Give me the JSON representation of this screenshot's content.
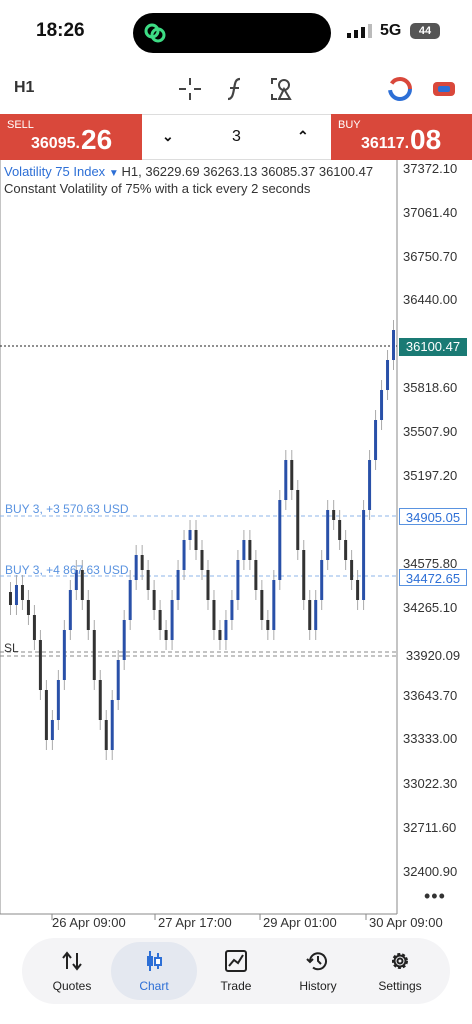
{
  "status": {
    "time": "18:26",
    "network": "5G",
    "battery": "44"
  },
  "toolbar": {
    "timeframe": "H1"
  },
  "trade": {
    "sell_label": "SELL",
    "sell_price_small": "36095.",
    "sell_price_big": "26",
    "buy_label": "BUY",
    "buy_price_small": "36117.",
    "buy_price_big": "08",
    "volume": "3"
  },
  "chart": {
    "symbol": "Volatility 75 Index",
    "ohlc": "H1, 36229.69 36263.13 36085.37 36100.47",
    "description": "Constant Volatility of 75% with a tick every 2 seconds",
    "price_axis": [
      "37372.10",
      "37061.40",
      "36750.70",
      "36440.00",
      "36100.47",
      "35818.60",
      "35507.90",
      "35197.20",
      "34905.05",
      "34575.80",
      "34472.65",
      "34265.10",
      "33920.09",
      "33643.70",
      "33333.00",
      "33022.30",
      "32711.60",
      "32400.90"
    ],
    "current_price": "36100.47",
    "order1_label": "BUY 3, +3 570.63 USD",
    "order1_price": "34905.05",
    "order2_label": "BUY 3, +4 867.63 USD",
    "order2_price": "34472.65",
    "sl_label": "SL",
    "sl_price": "33920.09",
    "time_axis": [
      "26 Apr 09:00",
      "27 Apr 17:00",
      "29 Apr 01:00",
      "30 Apr 09:00"
    ]
  },
  "colors": {
    "accent": "#2d6fd6",
    "sell_buy": "#d9483b",
    "bull": "#2950a8",
    "bear": "#333333",
    "current": "#1a7a74"
  },
  "tabs": [
    {
      "label": "Quotes",
      "icon": "quotes-icon"
    },
    {
      "label": "Chart",
      "icon": "chart-icon"
    },
    {
      "label": "Trade",
      "icon": "trade-icon"
    },
    {
      "label": "History",
      "icon": "history-icon"
    },
    {
      "label": "Settings",
      "icon": "settings-icon"
    }
  ]
}
